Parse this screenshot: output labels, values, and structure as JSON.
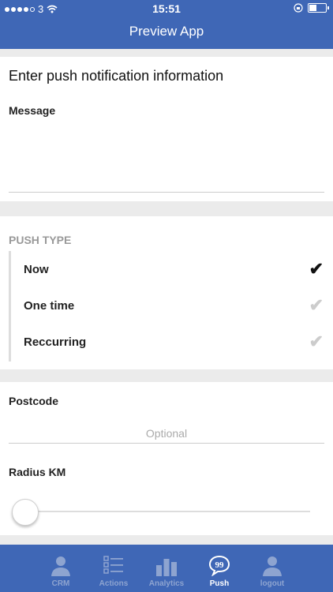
{
  "status": {
    "carrier": "3",
    "time": "15:51"
  },
  "navbar": {
    "title": "Preview App"
  },
  "form": {
    "heading": "Enter push notification information",
    "message_label": "Message",
    "push_type": {
      "heading": "PUSH TYPE",
      "items": [
        {
          "label": "Now",
          "selected": true
        },
        {
          "label": "One time",
          "selected": false
        },
        {
          "label": "Reccurring",
          "selected": false
        }
      ]
    },
    "postcode_label": "Postcode",
    "postcode_placeholder": "Optional",
    "radius_label": "Radius KM",
    "radius_value": 0
  },
  "tabbar": {
    "tabs": [
      {
        "label": "CRM",
        "icon": "person-icon"
      },
      {
        "label": "Actions",
        "icon": "list-icon"
      },
      {
        "label": "Analytics",
        "icon": "bar-chart-icon"
      },
      {
        "label": "Push",
        "icon": "speech-bubble-icon",
        "active": true
      },
      {
        "label": "logout",
        "icon": "person-icon"
      }
    ]
  },
  "colors": {
    "brand": "#3f67b6",
    "inactive_tab": "#8ea4d0"
  }
}
